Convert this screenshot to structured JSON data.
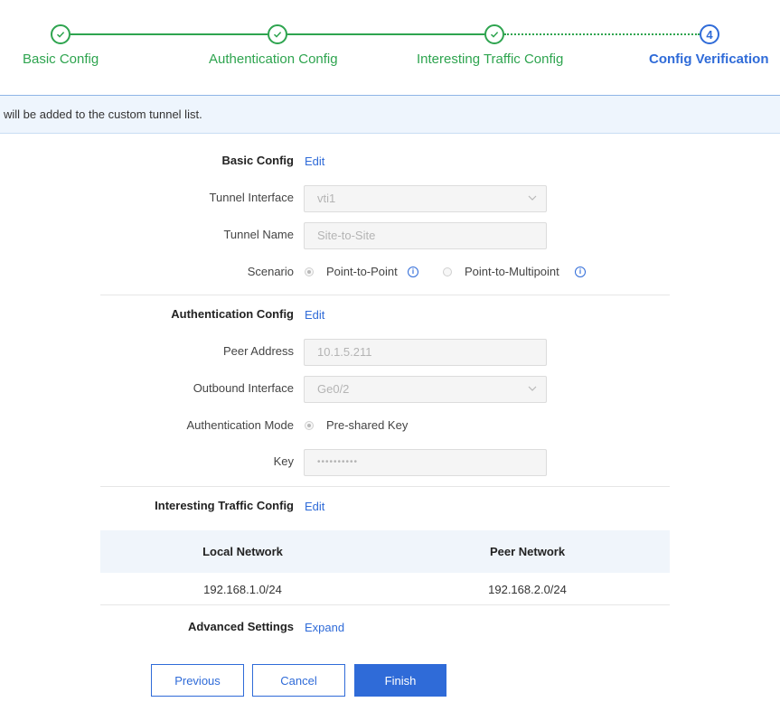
{
  "stepper": {
    "steps": [
      {
        "label": "Basic Config",
        "state": "done"
      },
      {
        "label": "Authentication Config",
        "state": "done"
      },
      {
        "label": "Interesting Traffic Config",
        "state": "done"
      },
      {
        "label": "Config Verification",
        "state": "current",
        "number": "4"
      }
    ]
  },
  "banner": {
    "text": "will be added to the custom tunnel list."
  },
  "basic_config": {
    "title": "Basic Config",
    "edit": "Edit",
    "tunnel_interface_label": "Tunnel Interface",
    "tunnel_interface_value": "vti1",
    "tunnel_name_label": "Tunnel Name",
    "tunnel_name_value": "Site-to-Site",
    "scenario_label": "Scenario",
    "scenario_options": [
      "Point-to-Point",
      "Point-to-Multipoint"
    ],
    "scenario_selected": "Point-to-Point"
  },
  "auth_config": {
    "title": "Authentication Config",
    "edit": "Edit",
    "peer_address_label": "Peer Address",
    "peer_address_value": "10.1.5.211",
    "outbound_interface_label": "Outbound Interface",
    "outbound_interface_value": "Ge0/2",
    "auth_mode_label": "Authentication Mode",
    "auth_mode_value": "Pre-shared Key",
    "key_label": "Key",
    "key_value": "••••••••••"
  },
  "traffic_config": {
    "title": "Interesting Traffic Config",
    "edit": "Edit",
    "columns": [
      "Local Network",
      "Peer Network"
    ],
    "rows": [
      [
        "192.168.1.0/24",
        "192.168.2.0/24"
      ]
    ]
  },
  "advanced": {
    "title": "Advanced Settings",
    "expand": "Expand"
  },
  "buttons": {
    "previous": "Previous",
    "cancel": "Cancel",
    "finish": "Finish"
  },
  "colors": {
    "done": "#2ea44f",
    "current": "#2f6bd8",
    "banner_bg": "#eef5fd"
  },
  "icons": {
    "done": "check-icon",
    "select": "chevron-down-icon",
    "help": "info-icon"
  }
}
